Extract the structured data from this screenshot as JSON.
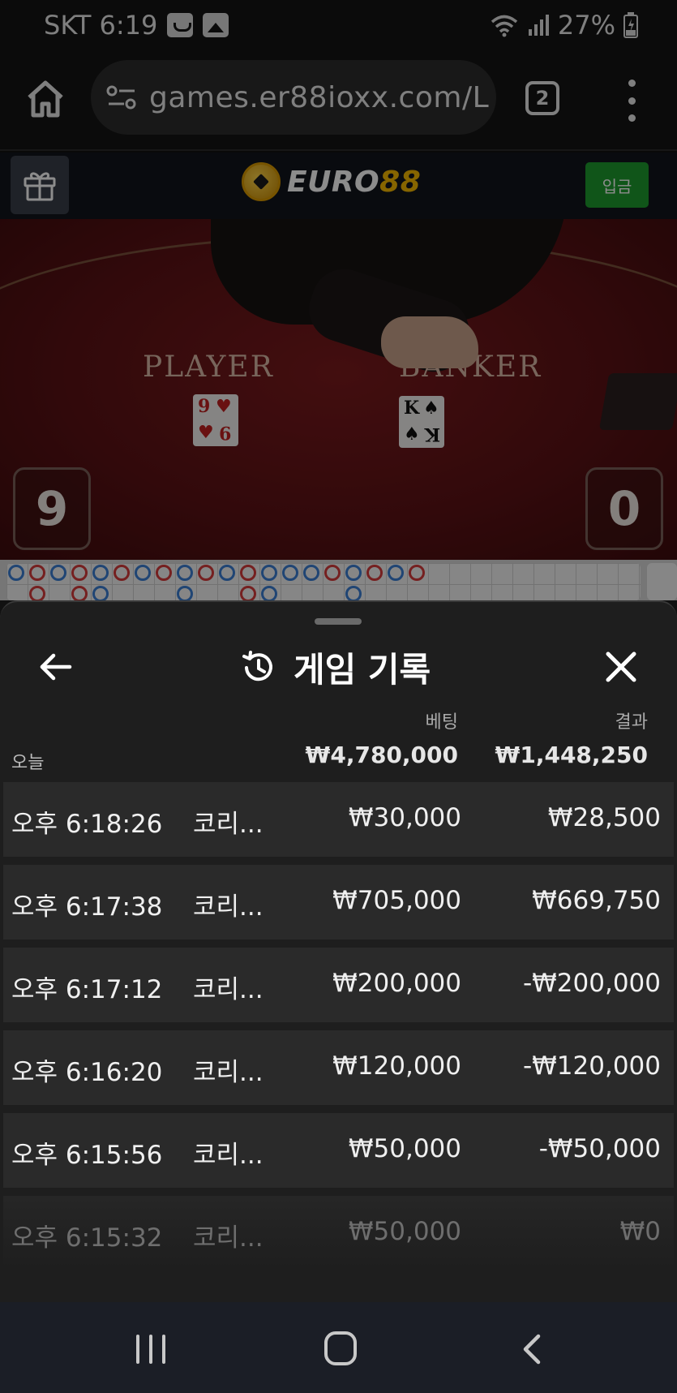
{
  "status_bar": {
    "carrier_time": "SKT 6:19",
    "battery": "27%",
    "icons": [
      "notification-icon",
      "image-icon",
      "wifi-icon",
      "signal-icon",
      "battery-icon"
    ]
  },
  "browser": {
    "url": "games.er88ioxx.com/L",
    "tab_count": "2"
  },
  "site_header": {
    "logo_euro": "EURO",
    "logo_num": "88",
    "deposit_label": "입금",
    "colors": {
      "deposit": "#1e9b2e",
      "logo_accent": "#f5b800"
    }
  },
  "video": {
    "player_label": "PLAYER",
    "banker_label": "BANKER",
    "player_score": "9",
    "banker_score": "0",
    "player_card": {
      "rank": "9",
      "suit": "♥"
    },
    "banker_card": {
      "rank": "K",
      "suit": "♠"
    }
  },
  "sheet": {
    "title": "게임 기록",
    "header_bet": "베팅",
    "header_result": "결과",
    "today_label": "오늘",
    "today_bet": "₩4,780,000",
    "today_result": "₩1,448,250",
    "rows": [
      {
        "time": "오후 6:18:26",
        "game": "코리...",
        "bet": "₩30,000",
        "result": "₩28,500"
      },
      {
        "time": "오후 6:17:38",
        "game": "코리...",
        "bet": "₩705,000",
        "result": "₩669,750"
      },
      {
        "time": "오후 6:17:12",
        "game": "코리...",
        "bet": "₩200,000",
        "result": "-₩200,000"
      },
      {
        "time": "오후 6:16:20",
        "game": "코리...",
        "bet": "₩120,000",
        "result": "-₩120,000"
      },
      {
        "time": "오후 6:15:56",
        "game": "코리...",
        "bet": "₩50,000",
        "result": "-₩50,000"
      },
      {
        "time": "오후 6:15:32",
        "game": "코리...",
        "bet": "₩50,000",
        "result": "₩0"
      }
    ]
  }
}
